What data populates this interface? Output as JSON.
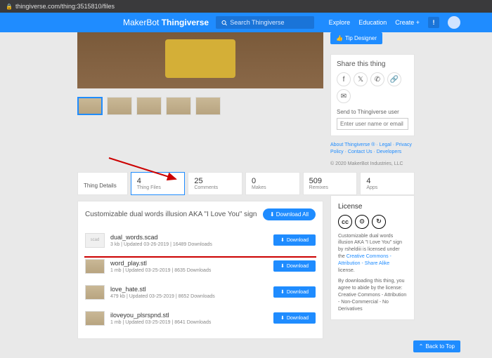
{
  "url": "thingiverse.com/thing:3515810/files",
  "brand": {
    "part1": "MakerBot",
    "part2": "Thingiverse"
  },
  "search": {
    "placeholder": "Search Thingiverse"
  },
  "nav": {
    "explore": "Explore",
    "education": "Education",
    "create": "Create +",
    "alert": "!"
  },
  "tip": {
    "label": "Tip Designer"
  },
  "share": {
    "title": "Share this thing",
    "send_label": "Send to Thingiverse user",
    "send_placeholder": "Enter user name or email"
  },
  "footer": {
    "links": "About Thingiverse ® · Legal · Privacy Policy · Contact Us · Developers",
    "copyright": "© 2020 MakerBot Industries, LLC"
  },
  "tabs": {
    "details": "Thing Details",
    "files": {
      "count": "4",
      "label": "Thing Files"
    },
    "comments": {
      "count": "25",
      "label": "Comments"
    },
    "makes": {
      "count": "0",
      "label": "Makes"
    },
    "remixes": {
      "count": "509",
      "label": "Remixes"
    },
    "apps": {
      "count": "4",
      "label": "Apps"
    }
  },
  "files_section": {
    "title": "Customizable dual words illusion AKA \"I Love You\" sign",
    "download_all": "Download All",
    "download": "Download",
    "scad_label": "scad",
    "items": [
      {
        "name": "dual_words.scad",
        "meta": "3 kb | Updated 03-26-2019 | 16489 Downloads",
        "type": "scad"
      },
      {
        "name": "word_play.stl",
        "meta": "1 mb | Updated 03-25-2019 | 8635 Downloads",
        "type": "stl"
      },
      {
        "name": "love_hate.stl",
        "meta": "479 kb | Updated 03-25-2019 | 8652 Downloads",
        "type": "stl"
      },
      {
        "name": "iloveyou_plsrspnd.stl",
        "meta": "1 mb | Updated 03-25-2019 | 8641 Downloads",
        "type": "stl"
      }
    ]
  },
  "license": {
    "title": "License",
    "text1": "Customizable dual words illusion AKA \"I Love You\" sign by rsheldiii is licensed under the ",
    "link1": "Creative Commons - Attribution - Share Alike",
    "text2": " license.",
    "text3": "By downloading this thing, you agree to abide by the license: Creative Commons - Attribution - Non-Commercial - No Derivatives"
  },
  "back_top": "Back to Top"
}
